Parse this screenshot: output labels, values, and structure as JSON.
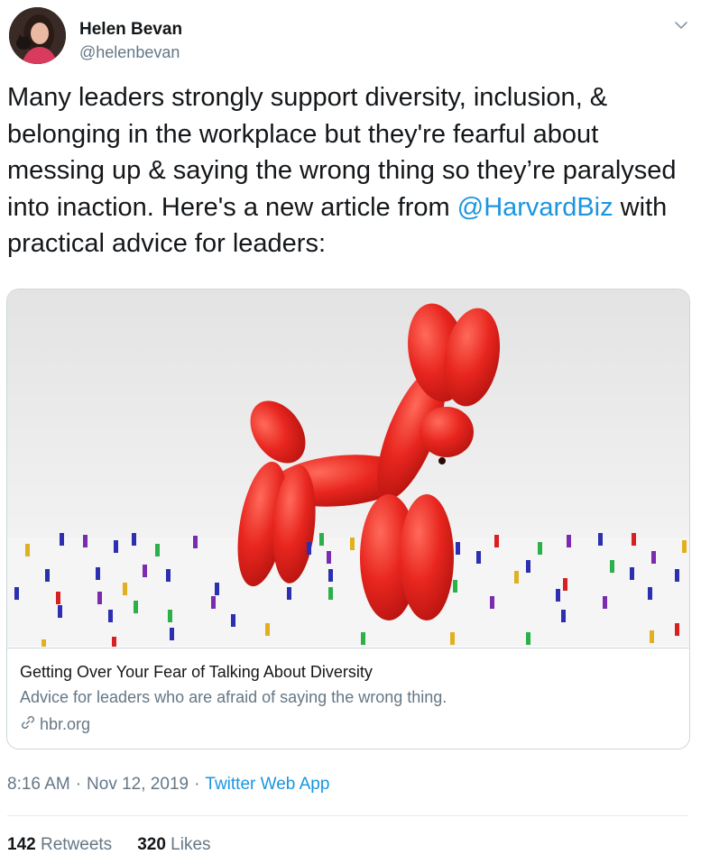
{
  "author": {
    "name": "Helen Bevan",
    "handle": "@helenbevan"
  },
  "tweet": {
    "text_before": "Many leaders strongly support diversity, inclusion, & belonging in the workplace but they're fearful about messing up & saying the wrong thing so they’re paralysed into inaction. Here's a new article from ",
    "mention": "@HarvardBiz",
    "text_after": " with practical advice for leaders:"
  },
  "card": {
    "title": "Getting Over Your Fear of Talking About Diversity",
    "description": "Advice for leaders who are afraid of saying the wrong thing.",
    "domain": "hbr.org"
  },
  "meta": {
    "time": "8:16 AM",
    "separator1": "·",
    "date": "Nov 12, 2019",
    "separator2": "·",
    "app": "Twitter Web App"
  },
  "stats": {
    "retweets_count": "142",
    "retweets_label": "Retweets",
    "likes_count": "320",
    "likes_label": "Likes"
  },
  "colors": {
    "link": "#1b95e0",
    "secondary_text": "#657786",
    "balloon_red": "#e8261f"
  },
  "icons": {
    "chevron": "chevron-down-icon",
    "link": "link-icon"
  }
}
